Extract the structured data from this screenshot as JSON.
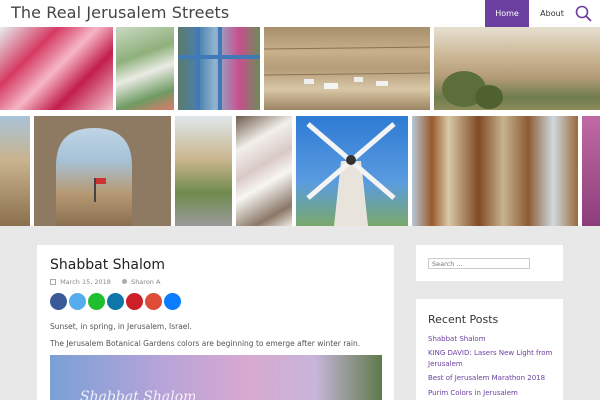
{
  "site": {
    "title": "The Real Jerusalem Streets"
  },
  "nav": {
    "home": "Home",
    "about": "About"
  },
  "post": {
    "title": "Shabbat Shalom",
    "date": "March 15, 2018",
    "author": "Sharon A",
    "paragraphs": [
      "Sunset, in spring, in Jerusalem, Israel.",
      "The Jerusalem Botanical Gardens colors are beginning to emerge after winter rain."
    ],
    "image_caption": "Shabbat Shalom"
  },
  "share_buttons": [
    {
      "network": "facebook",
      "color": "#3b5998"
    },
    {
      "network": "twitter",
      "color": "#55acee"
    },
    {
      "network": "whatsapp",
      "color": "#1fbf2f"
    },
    {
      "network": "linkedin",
      "color": "#0e76a8"
    },
    {
      "network": "pinterest",
      "color": "#cb2027"
    },
    {
      "network": "google-plus",
      "color": "#dd4b39"
    },
    {
      "network": "messenger",
      "color": "#0a7cff"
    }
  ],
  "sidebar": {
    "search_placeholder": "Search ...",
    "recent_title": "Recent Posts",
    "recent_posts": [
      "Shabbat Shalom",
      "KING DAVID: Lasers New Light from Jerusalem",
      "Best of Jerusalem Marathon 2018",
      "Purim Colors in Jerusalem"
    ]
  },
  "colors": {
    "accent": "#6b3fa0",
    "background": "#e8e8e8"
  }
}
